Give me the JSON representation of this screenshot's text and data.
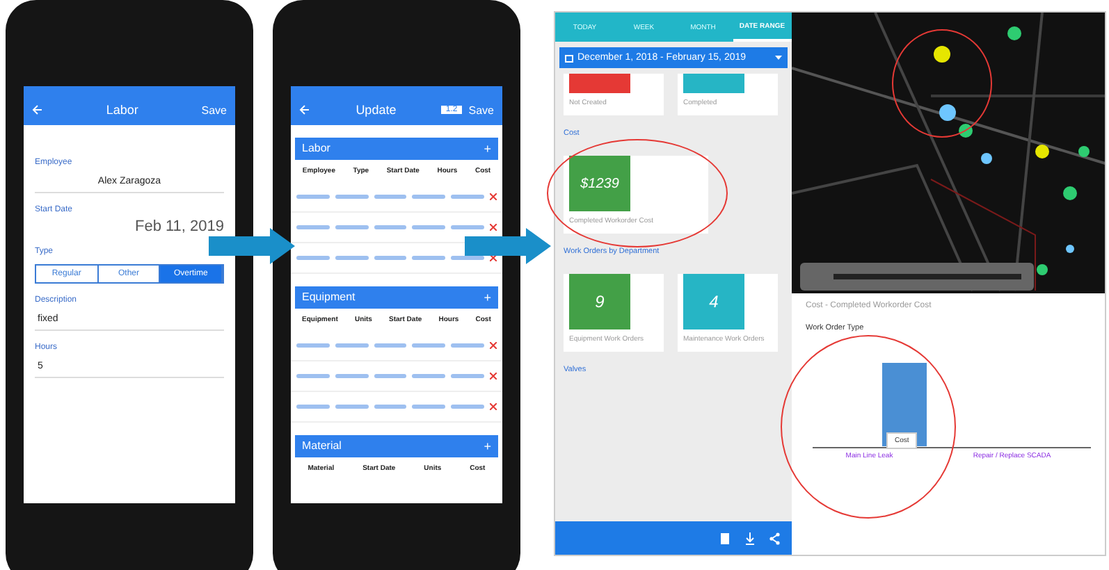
{
  "phones": [
    {
      "kind": "form",
      "header": {
        "title": "Labor",
        "action": "Save"
      },
      "fields": [
        {
          "kind": "text",
          "label": "Employee",
          "value": "Alex Zaragoza"
        },
        {
          "kind": "date",
          "label": "Start Date",
          "value": "Feb 11, 2019"
        },
        {
          "kind": "segments",
          "label": "Type",
          "options": [
            {
              "label": "Regular",
              "selected": false
            },
            {
              "label": "Other",
              "selected": false
            },
            {
              "label": "Overtime",
              "selected": true
            }
          ]
        },
        {
          "kind": "text",
          "label": "Description",
          "value": "fixed"
        },
        {
          "kind": "text",
          "label": "Hours",
          "value": "5"
        }
      ]
    },
    {
      "kind": "tables",
      "header": {
        "title": "Update",
        "badge": "1.2",
        "action": "Save"
      },
      "sections": [
        {
          "title": "Labor",
          "add": "+",
          "columns": [
            "Employee",
            "Type",
            "Start Date",
            "Hours",
            "Cost"
          ],
          "rows": [
            {
              "kind": "blurred"
            },
            {
              "kind": "blurred"
            },
            {
              "kind": "blurred"
            }
          ]
        },
        {
          "title": "Equipment",
          "add": "+",
          "columns": [
            "Equipment",
            "Units",
            "Start Date",
            "Hours",
            "Cost"
          ],
          "rows": [
            {
              "kind": "blurred"
            },
            {
              "kind": "blurred"
            },
            {
              "kind": "blurred"
            }
          ]
        },
        {
          "title": "Material",
          "add": "+",
          "columns": [
            "Material",
            "Start Date",
            "Units",
            "Cost"
          ]
        }
      ]
    }
  ],
  "dashboard": {
    "tabs": [
      {
        "label": "TODAY",
        "selected": false
      },
      {
        "label": "WEEK",
        "selected": false
      },
      {
        "label": "MONTH",
        "selected": false
      },
      {
        "label": "DATE RANGE",
        "selected": true
      }
    ],
    "date_range": "December 1, 2018 - February 15, 2019",
    "top_cards": [
      {
        "label": "Not Created",
        "color": "#e53935"
      },
      {
        "label": "Completed",
        "color": "#26b5c5"
      }
    ],
    "sections": [
      {
        "title": "Cost",
        "cards": [
          {
            "value": "$1239",
            "label": "Completed Workorder Cost",
            "color": "#43a047",
            "circled": true
          }
        ]
      },
      {
        "title": "Work Orders by Department",
        "cards": [
          {
            "value": "9",
            "label": "Equipment Work Orders",
            "color": "#43a047",
            "circled": false
          },
          {
            "value": "4",
            "label": "Maintenance Work Orders",
            "color": "#26b5c5",
            "circled": false
          }
        ]
      },
      {
        "title": "Valves"
      }
    ],
    "map": {
      "kind": "picture",
      "circled": true
    },
    "chart": {
      "title": "Cost - Completed Workorder Cost",
      "filter": "Work Order Type",
      "tooltip": "Cost",
      "categories": [
        "Main Line Leak",
        "Repair / Replace SCADA"
      ],
      "circled": true
    }
  }
}
